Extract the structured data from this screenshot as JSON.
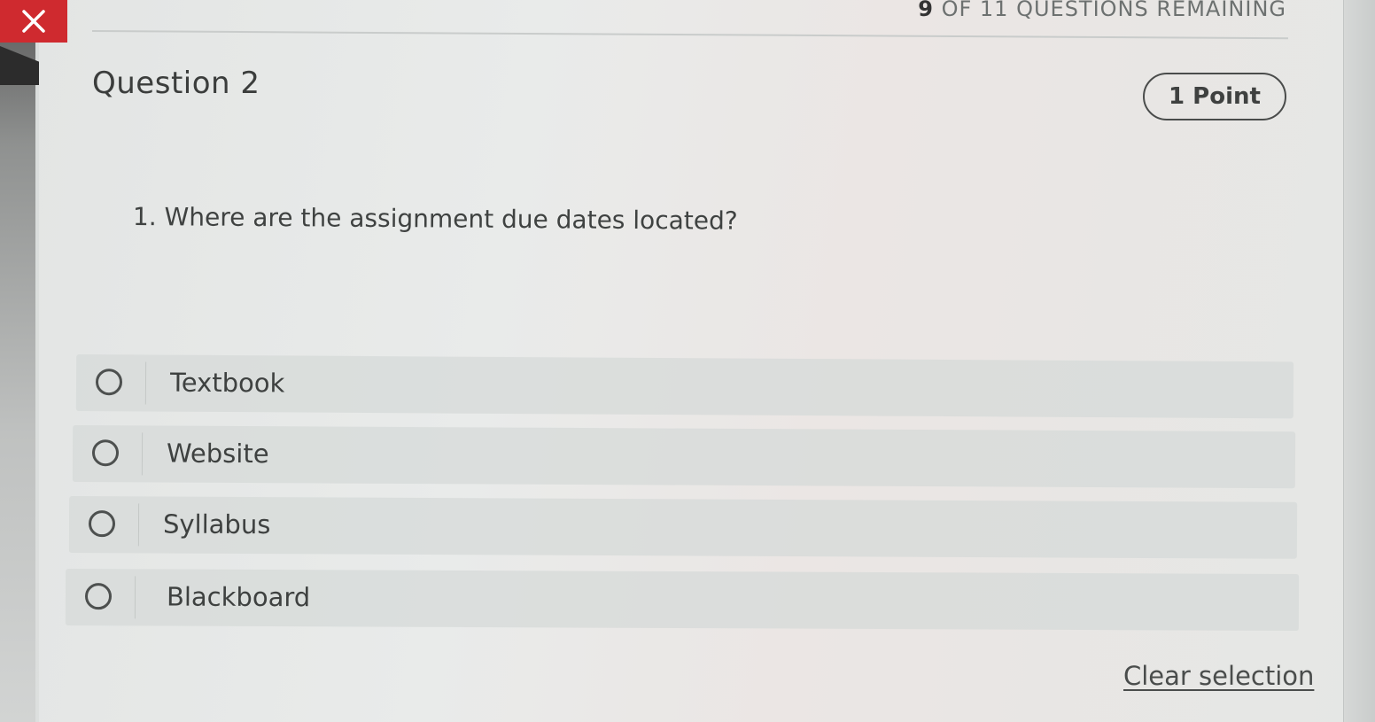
{
  "header": {
    "close_icon": "close-icon",
    "remaining_count": "9",
    "remaining_text": "OF 11 QUESTIONS REMAINING"
  },
  "question": {
    "title": "Question 2",
    "points": "1 Point",
    "text": "1. Where are the assignment due dates located?",
    "options": [
      {
        "label": "Textbook",
        "selected": false
      },
      {
        "label": "Website",
        "selected": false
      },
      {
        "label": "Syllabus",
        "selected": false
      },
      {
        "label": "Blackboard",
        "selected": false
      }
    ],
    "clear_label": "Clear selection"
  },
  "colors": {
    "close_button": "#cf2a2f",
    "background": "#e6e8e7",
    "option_row": "#d6dad8",
    "text": "#3e4140"
  }
}
